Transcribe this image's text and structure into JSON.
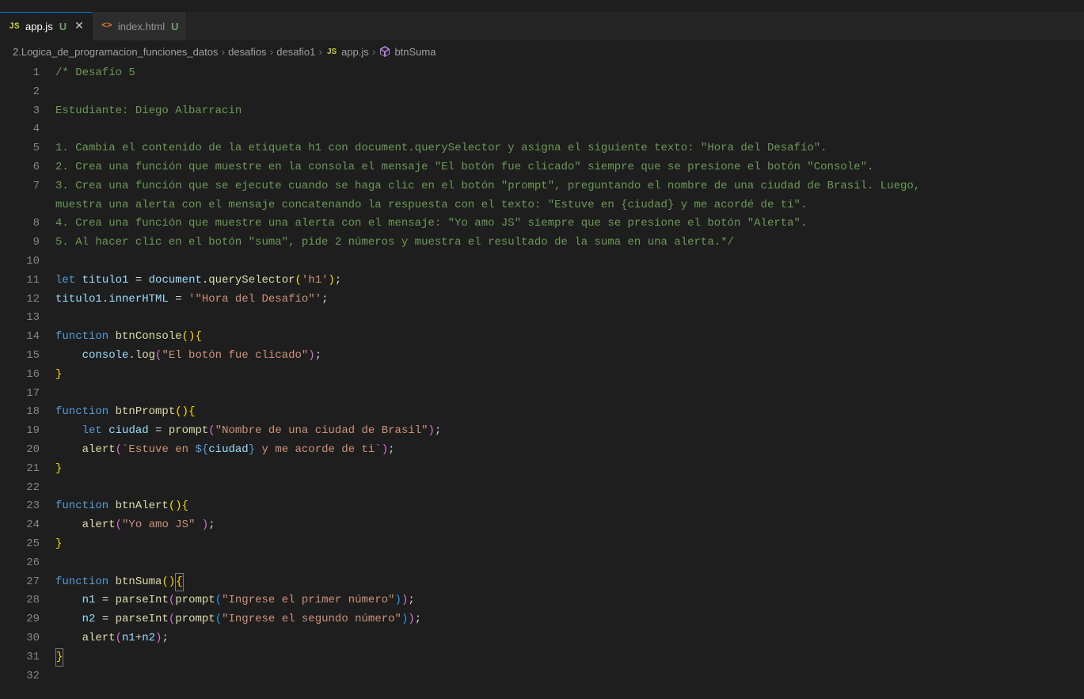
{
  "tabs": [
    {
      "icon": "JS",
      "label": "app.js",
      "modified": "U",
      "active": true
    },
    {
      "icon": "<>",
      "label": "index.html",
      "modified": "U",
      "active": false
    }
  ],
  "breadcrumb": {
    "path1": "2.Logica_de_programacion_funciones_datos",
    "path2": "desafios",
    "path3": "desafio1",
    "file": "app.js",
    "symbol": "btnSuma"
  },
  "code": {
    "lines": [
      {
        "n": 1,
        "tokens": [
          {
            "t": "/* Desafío 5",
            "c": "comment"
          }
        ]
      },
      {
        "n": 2,
        "tokens": []
      },
      {
        "n": 3,
        "tokens": [
          {
            "t": "Estudiante: Diego Albarracin",
            "c": "comment"
          }
        ]
      },
      {
        "n": 4,
        "tokens": []
      },
      {
        "n": 5,
        "tokens": [
          {
            "t": "1. Cambia el contenido de la etiqueta h1 con document.querySelector y asigna el siguiente texto: \"Hora del Desafío\".",
            "c": "comment"
          }
        ]
      },
      {
        "n": 6,
        "tokens": [
          {
            "t": "2. Crea una función que muestre en la consola el mensaje \"El botón fue clicado\" siempre que se presione el botón \"Console\".",
            "c": "comment"
          }
        ]
      },
      {
        "n": 7,
        "tokens": [
          {
            "t": "3. Crea una función que se ejecute cuando se haga clic en el botón \"prompt\", preguntando el nombre de una ciudad de Brasil. Luego, ",
            "c": "comment"
          }
        ]
      },
      {
        "n": "",
        "tokens": [
          {
            "t": "muestra una alerta con el mensaje concatenando la respuesta con el texto: \"Estuve en {ciudad} y me acordé de ti\".",
            "c": "comment"
          }
        ]
      },
      {
        "n": 8,
        "tokens": [
          {
            "t": "4. Crea una función que muestre una alerta con el mensaje: \"Yo amo JS\" siempre que se presione el botón \"Alerta\".",
            "c": "comment"
          }
        ]
      },
      {
        "n": 9,
        "tokens": [
          {
            "t": "5. Al hacer clic en el botón \"suma\", pide 2 números y muestra el resultado de la suma en una alerta.*/",
            "c": "comment"
          }
        ]
      },
      {
        "n": 10,
        "tokens": []
      },
      {
        "n": 11,
        "tokens": [
          {
            "t": "let",
            "c": "storage"
          },
          {
            "t": " ",
            "c": ""
          },
          {
            "t": "titulo1",
            "c": "variable"
          },
          {
            "t": " = ",
            "c": ""
          },
          {
            "t": "document",
            "c": "variable"
          },
          {
            "t": ".",
            "c": ""
          },
          {
            "t": "querySelector",
            "c": "function-name"
          },
          {
            "t": "(",
            "c": "brace"
          },
          {
            "t": "'h1'",
            "c": "string"
          },
          {
            "t": ")",
            "c": "brace"
          },
          {
            "t": ";",
            "c": ""
          }
        ]
      },
      {
        "n": 12,
        "tokens": [
          {
            "t": "titulo1",
            "c": "variable"
          },
          {
            "t": ".",
            "c": ""
          },
          {
            "t": "innerHTML",
            "c": "variable"
          },
          {
            "t": " = ",
            "c": ""
          },
          {
            "t": "'\"Hora del Desafío\"'",
            "c": "string"
          },
          {
            "t": ";",
            "c": ""
          }
        ]
      },
      {
        "n": 13,
        "tokens": []
      },
      {
        "n": 14,
        "tokens": [
          {
            "t": "function",
            "c": "storage"
          },
          {
            "t": " ",
            "c": ""
          },
          {
            "t": "btnConsole",
            "c": "function-name"
          },
          {
            "t": "()",
            "c": "brace"
          },
          {
            "t": "{",
            "c": "brace"
          }
        ]
      },
      {
        "n": 15,
        "tokens": [
          {
            "t": "    ",
            "c": ""
          },
          {
            "t": "console",
            "c": "variable"
          },
          {
            "t": ".",
            "c": ""
          },
          {
            "t": "log",
            "c": "function-name"
          },
          {
            "t": "(",
            "c": "brace-pink"
          },
          {
            "t": "\"El botón fue clicado\"",
            "c": "string"
          },
          {
            "t": ")",
            "c": "brace-pink"
          },
          {
            "t": ";",
            "c": ""
          }
        ]
      },
      {
        "n": 16,
        "tokens": [
          {
            "t": "}",
            "c": "brace"
          }
        ]
      },
      {
        "n": 17,
        "tokens": []
      },
      {
        "n": 18,
        "tokens": [
          {
            "t": "function",
            "c": "storage"
          },
          {
            "t": " ",
            "c": ""
          },
          {
            "t": "btnPrompt",
            "c": "function-name"
          },
          {
            "t": "()",
            "c": "brace"
          },
          {
            "t": "{",
            "c": "brace"
          }
        ]
      },
      {
        "n": 19,
        "tokens": [
          {
            "t": "    ",
            "c": ""
          },
          {
            "t": "let",
            "c": "storage"
          },
          {
            "t": " ",
            "c": ""
          },
          {
            "t": "ciudad",
            "c": "variable"
          },
          {
            "t": " = ",
            "c": ""
          },
          {
            "t": "prompt",
            "c": "function-name"
          },
          {
            "t": "(",
            "c": "brace-pink"
          },
          {
            "t": "\"Nombre de una ciudad de Brasil\"",
            "c": "string"
          },
          {
            "t": ")",
            "c": "brace-pink"
          },
          {
            "t": ";",
            "c": ""
          }
        ]
      },
      {
        "n": 20,
        "tokens": [
          {
            "t": "    ",
            "c": ""
          },
          {
            "t": "alert",
            "c": "function-name"
          },
          {
            "t": "(",
            "c": "brace-pink"
          },
          {
            "t": "`Estuve en ",
            "c": "string"
          },
          {
            "t": "${",
            "c": "template-expr"
          },
          {
            "t": "ciudad",
            "c": "template-var"
          },
          {
            "t": "}",
            "c": "template-expr"
          },
          {
            "t": " y me acorde de ti`",
            "c": "string"
          },
          {
            "t": ")",
            "c": "brace-pink"
          },
          {
            "t": ";",
            "c": ""
          }
        ]
      },
      {
        "n": 21,
        "tokens": [
          {
            "t": "}",
            "c": "brace"
          }
        ]
      },
      {
        "n": 22,
        "tokens": []
      },
      {
        "n": 23,
        "tokens": [
          {
            "t": "function",
            "c": "storage"
          },
          {
            "t": " ",
            "c": ""
          },
          {
            "t": "btnAlert",
            "c": "function-name"
          },
          {
            "t": "()",
            "c": "brace"
          },
          {
            "t": "{",
            "c": "brace"
          }
        ]
      },
      {
        "n": 24,
        "tokens": [
          {
            "t": "    ",
            "c": ""
          },
          {
            "t": "alert",
            "c": "function-name"
          },
          {
            "t": "(",
            "c": "brace-pink"
          },
          {
            "t": "\"Yo amo JS\"",
            "c": "string"
          },
          {
            "t": " ",
            "c": ""
          },
          {
            "t": ")",
            "c": "brace-pink"
          },
          {
            "t": ";",
            "c": ""
          }
        ]
      },
      {
        "n": 25,
        "tokens": [
          {
            "t": "}",
            "c": "brace"
          }
        ]
      },
      {
        "n": 26,
        "tokens": []
      },
      {
        "n": 27,
        "tokens": [
          {
            "t": "function",
            "c": "storage"
          },
          {
            "t": " ",
            "c": ""
          },
          {
            "t": "btnSuma",
            "c": "function-name"
          },
          {
            "t": "()",
            "c": "brace"
          },
          {
            "t": "{",
            "c": "brace",
            "boxed": true
          }
        ]
      },
      {
        "n": 28,
        "tokens": [
          {
            "t": "    ",
            "c": ""
          },
          {
            "t": "n1",
            "c": "variable"
          },
          {
            "t": " = ",
            "c": ""
          },
          {
            "t": "parseInt",
            "c": "function-name"
          },
          {
            "t": "(",
            "c": "brace-pink"
          },
          {
            "t": "prompt",
            "c": "function-name"
          },
          {
            "t": "(",
            "c": "brace-blue"
          },
          {
            "t": "\"Ingrese el primer número\"",
            "c": "string"
          },
          {
            "t": ")",
            "c": "brace-blue"
          },
          {
            "t": ")",
            "c": "brace-pink"
          },
          {
            "t": ";",
            "c": ""
          }
        ]
      },
      {
        "n": 29,
        "tokens": [
          {
            "t": "    ",
            "c": ""
          },
          {
            "t": "n2",
            "c": "variable"
          },
          {
            "t": " = ",
            "c": ""
          },
          {
            "t": "parseInt",
            "c": "function-name"
          },
          {
            "t": "(",
            "c": "brace-pink"
          },
          {
            "t": "prompt",
            "c": "function-name"
          },
          {
            "t": "(",
            "c": "brace-blue"
          },
          {
            "t": "\"Ingrese el segundo número\"",
            "c": "string"
          },
          {
            "t": ")",
            "c": "brace-blue"
          },
          {
            "t": ")",
            "c": "brace-pink"
          },
          {
            "t": ";",
            "c": ""
          }
        ]
      },
      {
        "n": 30,
        "tokens": [
          {
            "t": "    ",
            "c": ""
          },
          {
            "t": "alert",
            "c": "function-name"
          },
          {
            "t": "(",
            "c": "brace-pink"
          },
          {
            "t": "n1",
            "c": "variable"
          },
          {
            "t": "+",
            "c": ""
          },
          {
            "t": "n2",
            "c": "variable"
          },
          {
            "t": ")",
            "c": "brace-pink"
          },
          {
            "t": ";",
            "c": ""
          }
        ]
      },
      {
        "n": 31,
        "tokens": [
          {
            "t": "}",
            "c": "brace",
            "boxed": true
          }
        ]
      },
      {
        "n": 32,
        "tokens": []
      }
    ]
  }
}
